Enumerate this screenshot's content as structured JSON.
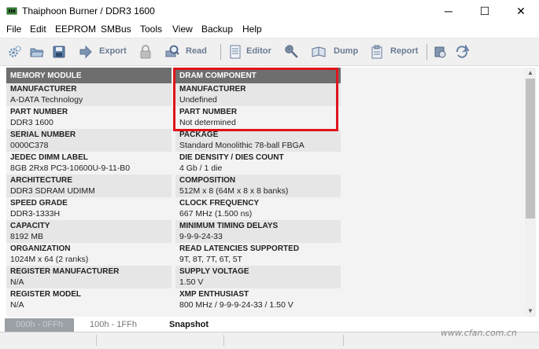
{
  "window": {
    "title": "Thaiphoon Burner / DDR3 1600",
    "minimize": "─",
    "maximize": "☐",
    "close": "✕"
  },
  "menu": [
    "File",
    "Edit",
    "EEPROM",
    "SMBus",
    "Tools",
    "View",
    "Backup",
    "Help"
  ],
  "toolbar": {
    "export": "Export",
    "read": "Read",
    "editor": "Editor",
    "dump": "Dump",
    "report": "Report"
  },
  "left_column": {
    "header": "MEMORY MODULE",
    "rows": [
      {
        "label": "MANUFACTURER",
        "value": "A-DATA Technology"
      },
      {
        "label": "PART NUMBER",
        "value": "DDR3 1600"
      },
      {
        "label": "SERIAL NUMBER",
        "value": "0000C378"
      },
      {
        "label": "JEDEC DIMM LABEL",
        "value": "8GB 2Rx8 PC3-10600U-9-11-B0"
      },
      {
        "label": "ARCHITECTURE",
        "value": "DDR3 SDRAM UDIMM"
      },
      {
        "label": "SPEED GRADE",
        "value": "DDR3-1333H"
      },
      {
        "label": "CAPACITY",
        "value": "8192 MB"
      },
      {
        "label": "ORGANIZATION",
        "value": "1024M x 64 (2 ranks)"
      },
      {
        "label": "REGISTER MANUFACTURER",
        "value": "N/A"
      },
      {
        "label": "REGISTER MODEL",
        "value": "N/A"
      }
    ]
  },
  "right_column": {
    "header": "DRAM COMPONENT",
    "rows": [
      {
        "label": "MANUFACTURER",
        "value": "Undefined"
      },
      {
        "label": "PART NUMBER",
        "value": "Not determined"
      },
      {
        "label": "PACKAGE",
        "value": "Standard Monolithic 78-ball FBGA"
      },
      {
        "label": "DIE DENSITY / DIES COUNT",
        "value": "4 Gb / 1 die"
      },
      {
        "label": "COMPOSITION",
        "value": "512M x 8 (64M x 8 x 8 banks)"
      },
      {
        "label": "CLOCK FREQUENCY",
        "value": "667 MHz (1.500 ns)"
      },
      {
        "label": "MINIMUM TIMING DELAYS",
        "value": "9-9-9-24-33"
      },
      {
        "label": "READ LATENCIES SUPPORTED",
        "value": "9T, 8T, 7T, 6T, 5T"
      },
      {
        "label": "SUPPLY VOLTAGE",
        "value": "1.50 V"
      },
      {
        "label": "XMP ENTHUSIAST",
        "value": "800 MHz / 9-9-9-24-33 / 1.50 V"
      }
    ]
  },
  "tabs": [
    "000h - 0FFh",
    "100h - 1FFh",
    "Snapshot"
  ],
  "watermark": "www.cfan.com.cn",
  "colors": {
    "header_bg": "#6e6e6e",
    "highlight": "#e0141b",
    "toolbar_label": "#6a7b93"
  }
}
